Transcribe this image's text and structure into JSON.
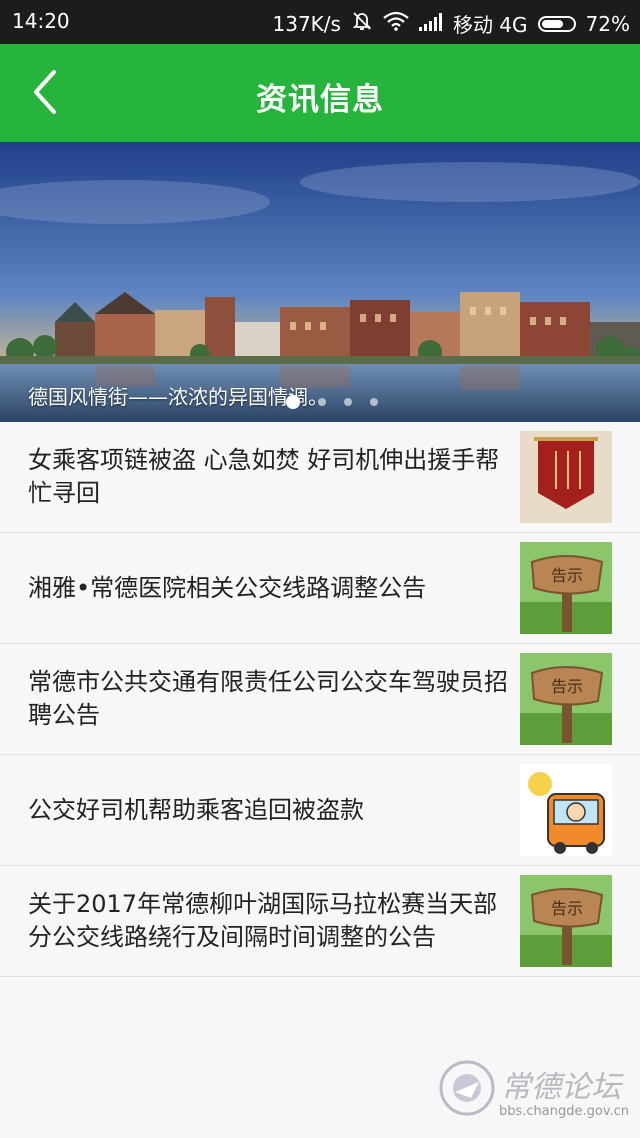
{
  "status_bar": {
    "time": "14:20",
    "speed": "137K/s",
    "carrier": "移动 4G",
    "battery": "72%",
    "battery_level": 0.72
  },
  "app_bar": {
    "title": "资讯信息",
    "back_icon": "chevron-left-icon",
    "color": "#27b43c"
  },
  "banner": {
    "caption": "德国风情街——浓浓的异国情调。",
    "slide_count": 4,
    "active_slide": 0
  },
  "news": [
    {
      "title": "女乘客项链被盗 心急如焚 好司机伸出援手帮忙寻回",
      "thumb": "red-banner-flag"
    },
    {
      "title": "湘雅•常德医院相关公交线路调整公告",
      "thumb": "notice-sign",
      "thumb_label": "告示"
    },
    {
      "title": "常德市公共交通有限责任公司公交车驾驶员招聘公告",
      "thumb": "notice-sign",
      "thumb_label": "告示"
    },
    {
      "title": "公交好司机帮助乘客追回被盗款",
      "thumb": "bus-driver-cartoon"
    },
    {
      "title": "关于2017年常德柳叶湖国际马拉松赛当天部分公交线路绕行及间隔时间调整的公告",
      "thumb": "notice-sign",
      "thumb_label": "告示"
    }
  ],
  "watermark": {
    "title": "常德论坛",
    "url": "bbs.changde.gov.cn"
  }
}
